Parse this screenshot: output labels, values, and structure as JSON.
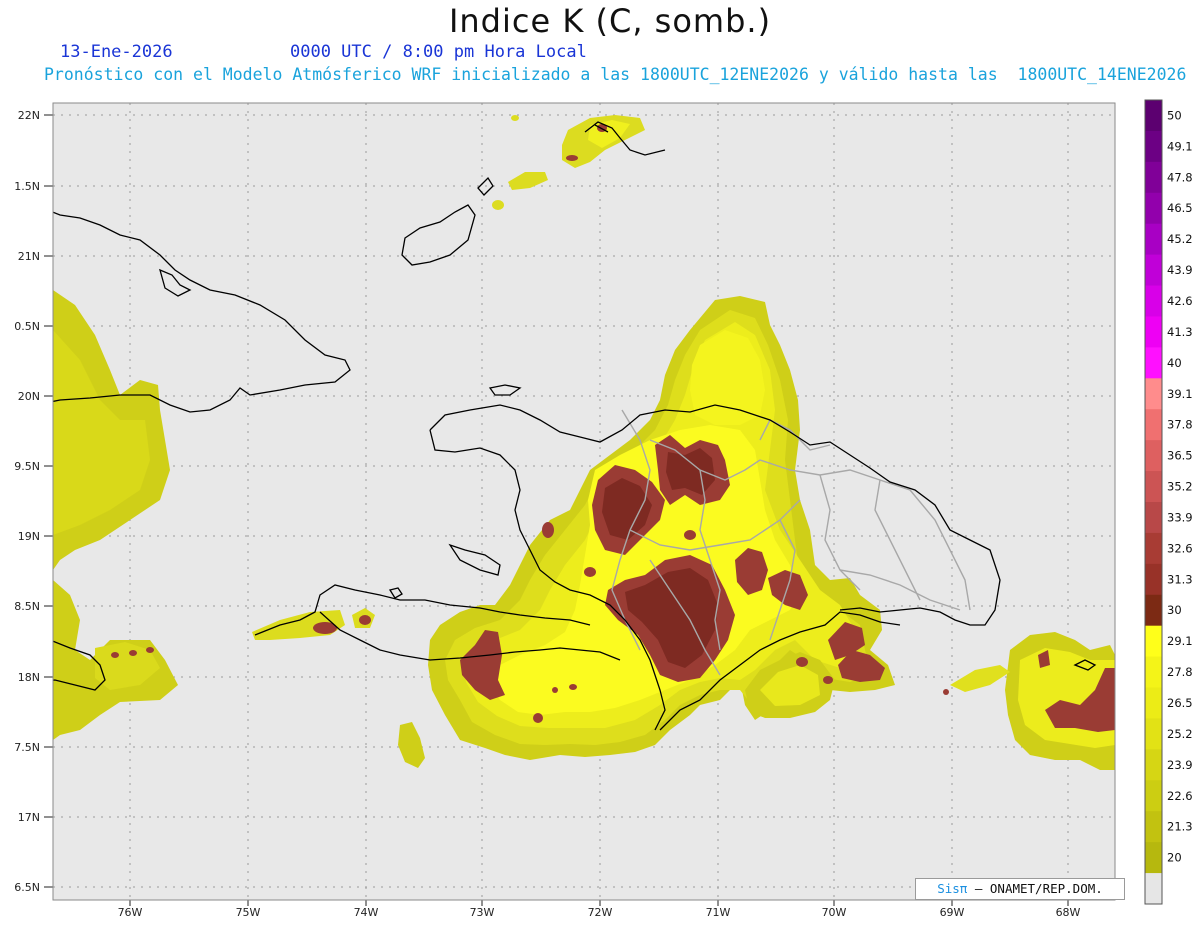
{
  "header": {
    "title": "Indice K (C, somb.)",
    "date": "13-Ene-2026",
    "time": "0000 UTC / 8:00 pm Hora Local",
    "subtitle": "Pronóstico con el Modelo Atmósferico WRF inicializado a las 1800UTC_12ENE2026 y válido hasta las  1800UTC_14ENE2026"
  },
  "axes": {
    "lat_labels": [
      "22N",
      "1.5N",
      "21N",
      "0.5N",
      "20N",
      "9.5N",
      "19N",
      "8.5N",
      "18N",
      "7.5N",
      "17N",
      "6.5N"
    ],
    "lon_labels": [
      "76W",
      "75W",
      "74W",
      "73W",
      "72W",
      "71W",
      "70W",
      "69W",
      "68W"
    ]
  },
  "colorbar": {
    "labels": [
      "50",
      "49.1",
      "47.8",
      "46.5",
      "45.2",
      "43.9",
      "42.6",
      "41.3",
      "40",
      "39.1",
      "37.8",
      "36.5",
      "35.2",
      "33.9",
      "32.6",
      "31.3",
      "30",
      "29.1",
      "27.8",
      "26.5",
      "25.2",
      "23.9",
      "22.6",
      "21.3",
      "20"
    ],
    "colors": [
      "#5c0070",
      "#6c0084",
      "#800098",
      "#9200ac",
      "#a800c4",
      "#c000d8",
      "#d800e8",
      "#ee00f4",
      "#ff10ff",
      "#ff8c8c",
      "#f07070",
      "#de6060",
      "#cc5454",
      "#b84848",
      "#a83c34",
      "#983228",
      "#7c2a14",
      "#ffff1a",
      "#f4f418",
      "#ecec16",
      "#e2e215",
      "#d6d614",
      "#ccce12",
      "#c2c210",
      "#b6b80e",
      "#e6e6e6"
    ]
  },
  "credit": {
    "brand": "Sisπ",
    "text": "– ONAMET/REP.DOM."
  }
}
